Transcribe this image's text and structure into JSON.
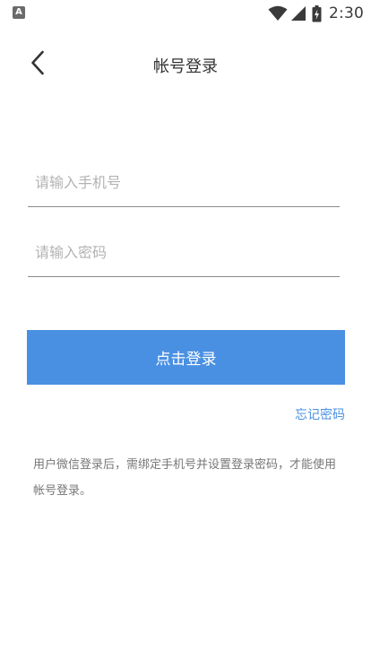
{
  "status_bar": {
    "app_icon_letter": "A",
    "icons": [
      "wifi-icon",
      "cellular-signal-icon",
      "battery-charging-icon"
    ],
    "time": "2:30"
  },
  "header": {
    "back_icon": "chevron-left-icon",
    "title": "帐号登录"
  },
  "form": {
    "phone_placeholder": "请输入手机号",
    "phone_value": "",
    "password_placeholder": "请输入密码",
    "password_value": "",
    "login_label": "点击登录",
    "forgot_label": "忘记密码"
  },
  "notice": "用户微信登录后，需绑定手机号并设置登录密码，才能使用帐号登录。",
  "colors": {
    "accent": "#4a90e2",
    "text_primary": "#333333",
    "text_secondary": "#777777",
    "placeholder": "#b3b3b3",
    "divider": "#8a8a8a"
  }
}
